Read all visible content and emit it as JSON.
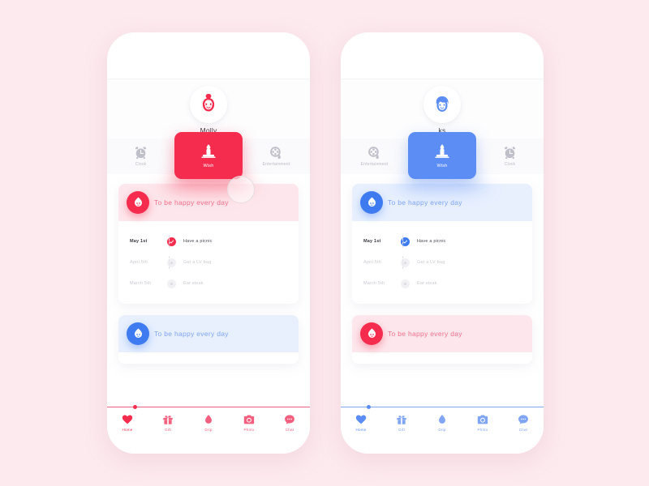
{
  "background_color": "#FCEAEE",
  "theme": {
    "red": "#F52C4E",
    "red_light": "#FDE7EC",
    "red_text": "#F06F8C",
    "blue": "#5B8DF5",
    "blue_deep": "#3E7BF0",
    "blue_light": "#E8F0FE",
    "blue_text": "#7FA5F3",
    "gray_icon": "#BFBFC9"
  },
  "phones": [
    {
      "id": "phone-left",
      "accent": "red",
      "user": {
        "name": "Molly",
        "avatar_icon": "girl-avatar-icon"
      },
      "tabs": [
        {
          "label": "Clock",
          "icon": "alarm-clock-icon",
          "active": false
        },
        {
          "label": "Wish",
          "icon": "candle-icon",
          "active": true
        },
        {
          "label": "Entertainment",
          "icon": "film-reel-icon",
          "active": false
        }
      ],
      "cards": [
        {
          "theme": "red",
          "badge_icon": "flame-face-icon",
          "title": "To be happy every day",
          "todos": [
            {
              "date": "May 1st",
              "text": "Have a picnic",
              "done": true
            },
            {
              "date": "April 5th",
              "text": "Get a LV bag",
              "done": false
            },
            {
              "date": "March 5th",
              "text": "Eat steak",
              "done": false
            }
          ]
        },
        {
          "theme": "blue",
          "badge_icon": "flame-face-icon",
          "title": "To be happy every day",
          "todos": []
        }
      ],
      "nav": [
        {
          "label": "Home",
          "icon": "heart-icon",
          "active": true
        },
        {
          "label": "Gift",
          "icon": "gift-icon",
          "active": false
        },
        {
          "label": "Drip",
          "icon": "drop-icon",
          "active": false
        },
        {
          "label": "Photo",
          "icon": "camera-icon",
          "active": false
        },
        {
          "label": "Chat",
          "icon": "chat-icon",
          "active": false
        }
      ]
    },
    {
      "id": "phone-right",
      "accent": "blue",
      "user": {
        "name": "ks",
        "avatar_icon": "boy-avatar-icon"
      },
      "tabs": [
        {
          "label": "Entertainment",
          "icon": "film-reel-icon",
          "active": false
        },
        {
          "label": "Wish",
          "icon": "candle-icon",
          "active": true
        },
        {
          "label": "Clock",
          "icon": "alarm-clock-icon",
          "active": false
        }
      ],
      "cards": [
        {
          "theme": "blue",
          "badge_icon": "flame-face-icon",
          "title": "To be happy every day",
          "todos": [
            {
              "date": "May 1st",
              "text": "Have a picnic",
              "done": true
            },
            {
              "date": "April 5th",
              "text": "Get a LV bag",
              "done": false
            },
            {
              "date": "March 5th",
              "text": "Eat steak",
              "done": false
            }
          ]
        },
        {
          "theme": "red",
          "badge_icon": "flame-face-icon",
          "title": "To be happy every day",
          "todos": []
        }
      ],
      "nav": [
        {
          "label": "Home",
          "icon": "heart-icon",
          "active": true
        },
        {
          "label": "Gift",
          "icon": "gift-icon",
          "active": false
        },
        {
          "label": "Drip",
          "icon": "drop-icon",
          "active": false
        },
        {
          "label": "Photo",
          "icon": "camera-icon",
          "active": false
        },
        {
          "label": "Chat",
          "icon": "chat-icon",
          "active": false
        }
      ]
    }
  ]
}
